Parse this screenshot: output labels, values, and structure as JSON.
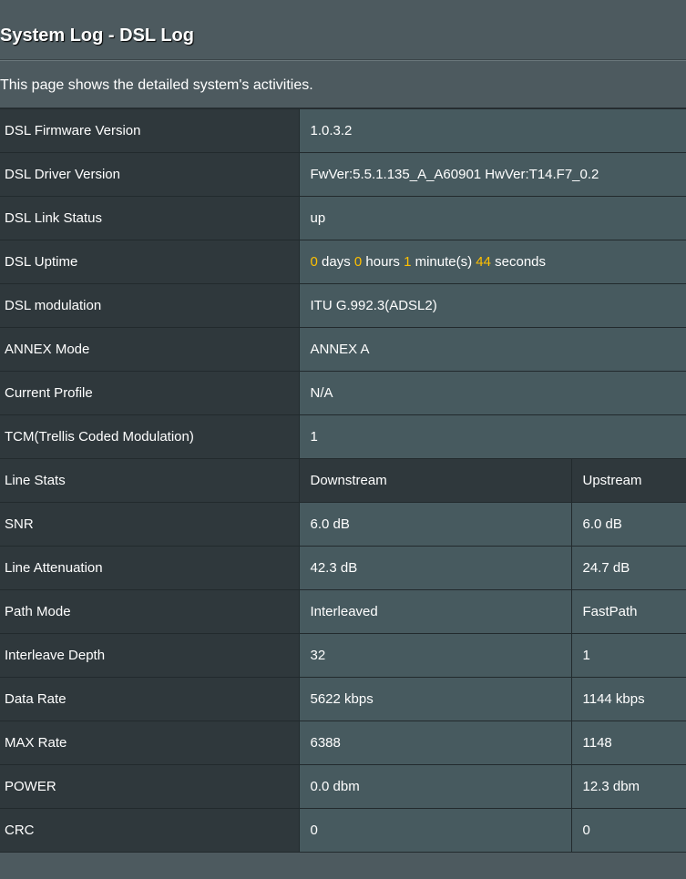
{
  "header": {
    "title": "System Log - DSL Log",
    "description": "This page shows the detailed system's activities."
  },
  "info_rows": [
    {
      "label": "DSL Firmware Version",
      "value": "1.0.3.2"
    },
    {
      "label": "DSL Driver Version",
      "value": "FwVer:5.5.1.135_A_A60901 HwVer:T14.F7_0.2"
    },
    {
      "label": "DSL Link Status",
      "value": "up"
    },
    {
      "label": "DSL Uptime"
    },
    {
      "label": "DSL modulation",
      "value": "ITU G.992.3(ADSL2)"
    },
    {
      "label": "ANNEX Mode",
      "value": "ANNEX A"
    },
    {
      "label": "Current Profile",
      "value": "N/A"
    },
    {
      "label": "TCM(Trellis Coded Modulation)",
      "value": "1"
    }
  ],
  "uptime": {
    "days": "0",
    "days_unit": "days",
    "hours": "0",
    "hours_unit": "hours",
    "minutes": "1",
    "minutes_unit": "minute(s)",
    "seconds": "44",
    "seconds_unit": "seconds"
  },
  "line_stats": {
    "header": {
      "label": "Line Stats",
      "downstream": "Downstream",
      "upstream": "Upstream"
    },
    "rows": [
      {
        "label": "SNR",
        "downstream": "6.0 dB",
        "upstream": "6.0 dB"
      },
      {
        "label": "Line Attenuation",
        "downstream": "42.3 dB",
        "upstream": "24.7 dB"
      },
      {
        "label": "Path Mode",
        "downstream": "Interleaved",
        "upstream": "FastPath"
      },
      {
        "label": "Interleave Depth",
        "downstream": "32",
        "upstream": "1"
      },
      {
        "label": "Data Rate",
        "downstream": "5622 kbps",
        "upstream": "1144 kbps"
      },
      {
        "label": "MAX Rate",
        "downstream": "6388",
        "upstream": "1148"
      },
      {
        "label": "POWER",
        "downstream": "0.0 dbm",
        "upstream": "12.3 dbm"
      },
      {
        "label": "CRC",
        "downstream": "0",
        "upstream": "0"
      }
    ]
  }
}
